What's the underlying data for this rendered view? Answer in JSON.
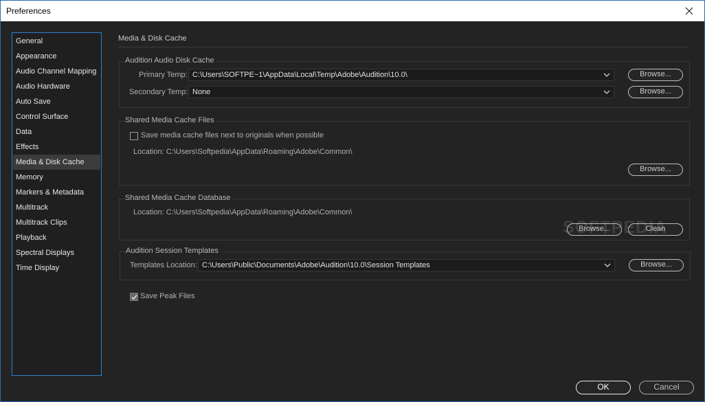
{
  "window": {
    "title": "Preferences",
    "close_icon": "close-icon"
  },
  "sidebar": {
    "items": [
      {
        "label": "General"
      },
      {
        "label": "Appearance"
      },
      {
        "label": "Audio Channel Mapping"
      },
      {
        "label": "Audio Hardware"
      },
      {
        "label": "Auto Save"
      },
      {
        "label": "Control Surface"
      },
      {
        "label": "Data"
      },
      {
        "label": "Effects"
      },
      {
        "label": "Media & Disk Cache"
      },
      {
        "label": "Memory"
      },
      {
        "label": "Markers & Metadata"
      },
      {
        "label": "Multitrack"
      },
      {
        "label": "Multitrack Clips"
      },
      {
        "label": "Playback"
      },
      {
        "label": "Spectral Displays"
      },
      {
        "label": "Time Display"
      }
    ],
    "selected": "Media & Disk Cache"
  },
  "main": {
    "heading": "Media & Disk Cache",
    "disk_cache": {
      "title": "Audition Audio Disk Cache",
      "primary_label": "Primary Temp:",
      "primary_value": "C:\\Users\\SOFTPE~1\\AppData\\Local\\Temp\\Adobe\\Audition\\10.0\\",
      "secondary_label": "Secondary Temp:",
      "secondary_value": "None",
      "browse_label": "Browse..."
    },
    "shared_files": {
      "title": "Shared Media Cache Files",
      "checkbox_label": "Save media cache files next to originals when possible",
      "checkbox_checked": false,
      "location": "Location: C:\\Users\\Softpedia\\AppData\\Roaming\\Adobe\\Common\\",
      "browse_label": "Browse..."
    },
    "shared_db": {
      "title": "Shared Media Cache Database",
      "location": "Location: C:\\Users\\Softpedia\\AppData\\Roaming\\Adobe\\Common\\",
      "browse_label": "Browse...",
      "clean_label": "Clean"
    },
    "session_templates": {
      "title": "Audition Session Templates",
      "location_label": "Templates Location:",
      "location_value": "C:\\Users\\Public\\Documents\\Adobe\\Audition\\10.0\\Session Templates",
      "browse_label": "Browse..."
    },
    "save_peak": {
      "label": "Save Peak Files",
      "checked": true
    },
    "watermark": "SOFTPEDIA"
  },
  "footer": {
    "ok_label": "OK",
    "cancel_label": "Cancel"
  },
  "colors": {
    "accent": "#2f7fd0",
    "background": "#232323",
    "selected": "#3b3b3b"
  }
}
